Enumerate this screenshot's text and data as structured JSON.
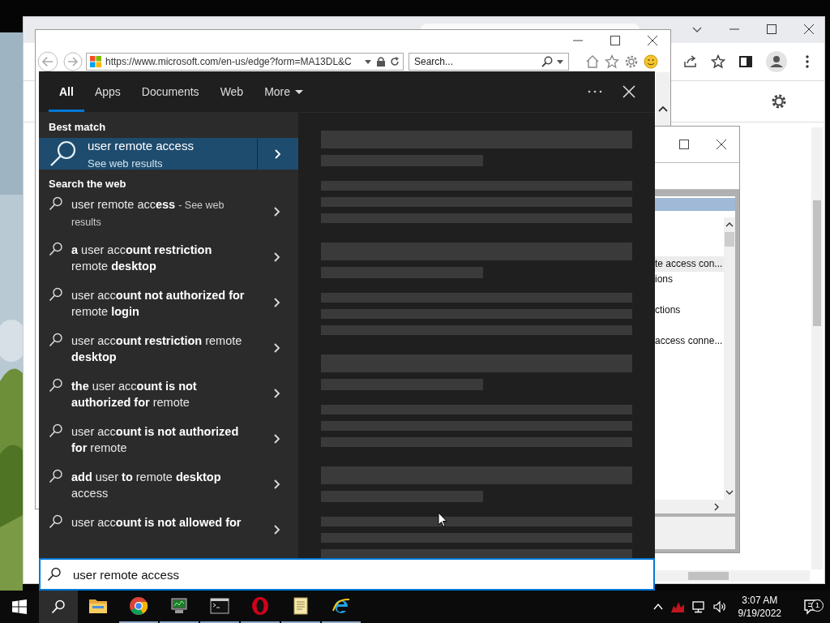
{
  "ie_window": {
    "address": "https://www.microsoft.com/en-us/edge?form=MA13DL&C",
    "search": {
      "placeholder": "Search..."
    }
  },
  "dialog_window": {
    "list_items": [
      {
        "text": "te access con...",
        "selected": true
      },
      {
        "text": "ions",
        "selected": false
      },
      {
        "text": "ctions",
        "selected": false
      },
      {
        "text": "access conne...",
        "selected": false
      }
    ]
  },
  "search_panel": {
    "tabs": [
      {
        "label": "All",
        "selected": true,
        "kind": "plain"
      },
      {
        "label": "Apps",
        "selected": false,
        "kind": "plain"
      },
      {
        "label": "Documents",
        "selected": false,
        "kind": "plain"
      },
      {
        "label": "Web",
        "selected": false,
        "kind": "plain"
      },
      {
        "label": "More",
        "selected": false,
        "kind": "dropdown"
      }
    ],
    "best_match": {
      "heading": "Best match",
      "title": "user remote access",
      "subtitle": "See web results"
    },
    "web_section": {
      "heading": "Search the web",
      "suggestions": [
        {
          "text": "user remote acc**ess**",
          "suffix": "- See web results"
        },
        {
          "text": "**a** user acc**ount restriction** remote **desktop**"
        },
        {
          "text": "user acc**ount not authorized for** remote **login**"
        },
        {
          "text": "user acc**ount restriction** remote **desktop**"
        },
        {
          "text": "**the** user acc**ount is not authorized for** remote"
        },
        {
          "text": "user acc**ount is not authorized for** remote"
        },
        {
          "text": "**add** user **to** remote **desktop** access"
        },
        {
          "text": "user acc**ount is not allowed for**"
        }
      ]
    },
    "search_box": {
      "value": "user remote access"
    }
  },
  "taskbar": {
    "apps": [
      {
        "kind": "folder",
        "running": false
      },
      {
        "kind": "chrome",
        "running": true
      },
      {
        "kind": "monitor",
        "running": true
      },
      {
        "kind": "terminal",
        "running": true
      },
      {
        "kind": "opera",
        "running": true
      },
      {
        "kind": "notepad",
        "running": true
      },
      {
        "kind": "ie",
        "running": true
      }
    ],
    "clock": {
      "time": "3:07 AM",
      "date": "9/19/2022"
    },
    "notifications": {
      "count": "1"
    }
  }
}
